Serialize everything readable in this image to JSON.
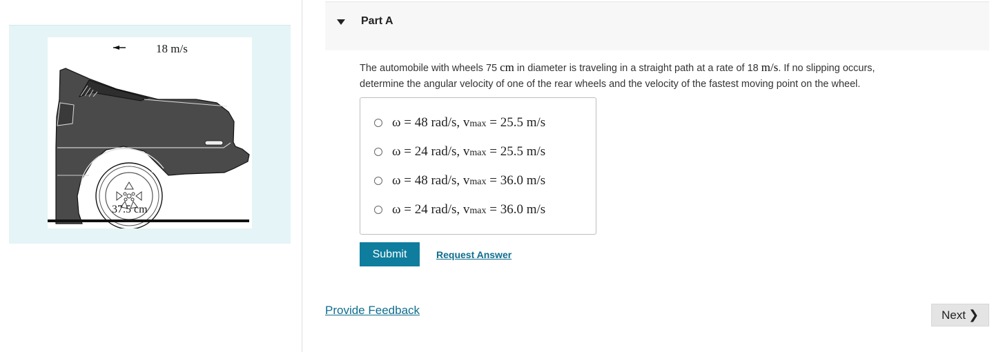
{
  "figure": {
    "speed_label": "18 m/s",
    "radius_label": "37.5 cm",
    "omega_label": "ω"
  },
  "part": {
    "title": "Part A",
    "toggle_icon": "caret-down-icon"
  },
  "question": {
    "text_1": "The automobile with wheels 75 ",
    "unit_cm": "cm",
    "text_2": " in diameter is traveling in a straight path at a rate of 18 ",
    "unit_ms": "m/s",
    "text_3": ". If no slipping occurs,",
    "text_4": "determine the angular velocity of one of the rear wheels and the velocity of the fastest moving point on the wheel."
  },
  "choices": [
    {
      "omega": "ω = 48 rad/s, ",
      "vmax_sym": "v",
      "vmax_sub": "max",
      "vmax_val": " = 25.5 m/s"
    },
    {
      "omega": "ω = 24 rad/s, ",
      "vmax_sym": "v",
      "vmax_sub": "max",
      "vmax_val": " = 25.5 m/s"
    },
    {
      "omega": "ω = 48 rad/s, ",
      "vmax_sym": "v",
      "vmax_sub": "max",
      "vmax_val": " = 36.0 m/s"
    },
    {
      "omega": "ω = 24 rad/s, ",
      "vmax_sym": "v",
      "vmax_sub": "max",
      "vmax_val": " = 36.0 m/s"
    }
  ],
  "actions": {
    "submit": "Submit",
    "request_answer": "Request Answer",
    "provide_feedback": "Provide Feedback",
    "next": "Next",
    "next_icon": "chevron-right-icon"
  },
  "colors": {
    "accent": "#0f7d9e",
    "link": "#0f6d8e",
    "figure_bg": "#e5f4f6",
    "car_body": "#4a4a4a"
  }
}
